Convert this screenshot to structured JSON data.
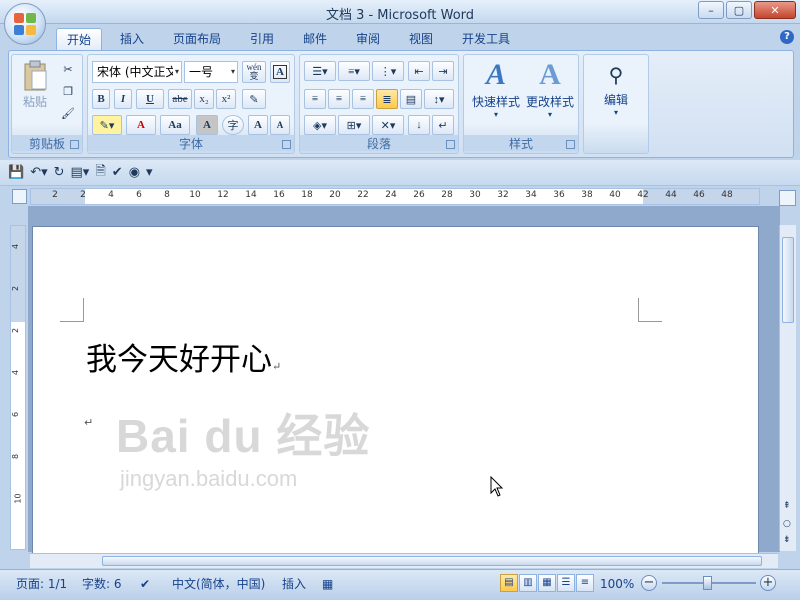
{
  "window": {
    "title": "文档 3 - Microsoft Word",
    "controls": [
      "–",
      "▢",
      "✕"
    ]
  },
  "tabs": [
    "开始",
    "插入",
    "页面布局",
    "引用",
    "邮件",
    "审阅",
    "视图",
    "开发工具"
  ],
  "active_tab": "开始",
  "ribbon": {
    "clipboard": {
      "label": "剪贴板",
      "paste": "粘贴"
    },
    "font": {
      "label": "字体",
      "font_name": "宋体 (中文正文)",
      "font_size": "一号",
      "wen_button": "wén\n变",
      "buttons": [
        "B",
        "I",
        "U",
        "abe",
        "x₂",
        "x²",
        "A",
        "Aa",
        "A",
        "字",
        "A",
        "A"
      ]
    },
    "paragraph": {
      "label": "段落"
    },
    "styles": {
      "label": "样式",
      "quick": "快速样式",
      "change": "更改样式"
    },
    "editing": {
      "label": "编辑",
      "edit": "编辑"
    }
  },
  "ruler": {
    "h_numbers": [
      "2",
      "2",
      "4",
      "6",
      "8",
      "10",
      "12",
      "14",
      "16",
      "18",
      "20",
      "22",
      "24",
      "26",
      "28",
      "30",
      "32",
      "34",
      "36",
      "38",
      "40",
      "42",
      "44",
      "46",
      "48"
    ],
    "v_numbers": [
      "4",
      "2",
      "2",
      "4",
      "6",
      "8",
      "10"
    ]
  },
  "document": {
    "line1": "我今天好开心",
    "para_mark": "↵"
  },
  "watermark": {
    "big": "Bai du 经验",
    "small": "jingyan.baidu.com"
  },
  "statusbar": {
    "page": "页面: 1/1",
    "words": "字数: 6",
    "language": "中文(简体，中国)",
    "mode": "插入",
    "zoom": "100%",
    "zoom_minus": "−",
    "zoom_plus": "+"
  },
  "colors": {
    "accent": "#15428b",
    "ribbon_bg": "#d1e0f2",
    "highlight": "#ffc94a"
  }
}
